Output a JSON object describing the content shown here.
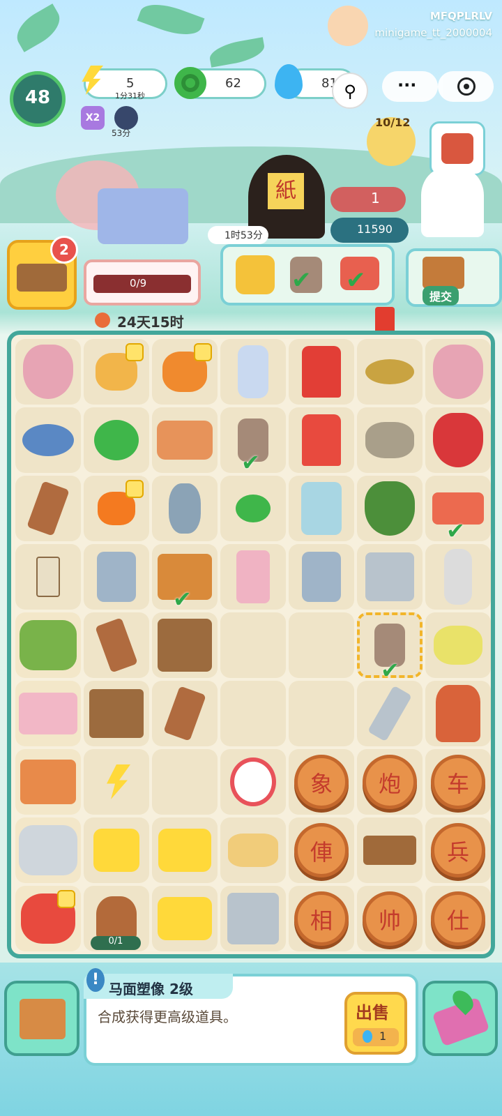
{
  "watermark": {
    "line1": "MFQPLRLV",
    "line2": "minigame_tt_2000004"
  },
  "player": {
    "level": "48"
  },
  "resources": {
    "energy": "5",
    "energy_timer": "1分31秒",
    "coins": "62",
    "gems": "816",
    "boost": "X2",
    "boost_timer": "53分"
  },
  "event": {
    "progress_count": "10/12",
    "chips": "1",
    "gems_reward": "11590",
    "timer": "1时53分"
  },
  "orders": {
    "box_badge": "2",
    "progress": "0/9",
    "countdown": "24天15时",
    "submit_label": "提交"
  },
  "board": {
    "doll_progress": "0/1",
    "chess": [
      "象",
      "炮",
      "车",
      "俥",
      "兵",
      "相",
      "帅",
      "仕"
    ]
  },
  "item": {
    "title": "马面塑像 2级",
    "description": "合成获得更高级道具。",
    "sell_label": "出售",
    "sell_price": "1"
  }
}
